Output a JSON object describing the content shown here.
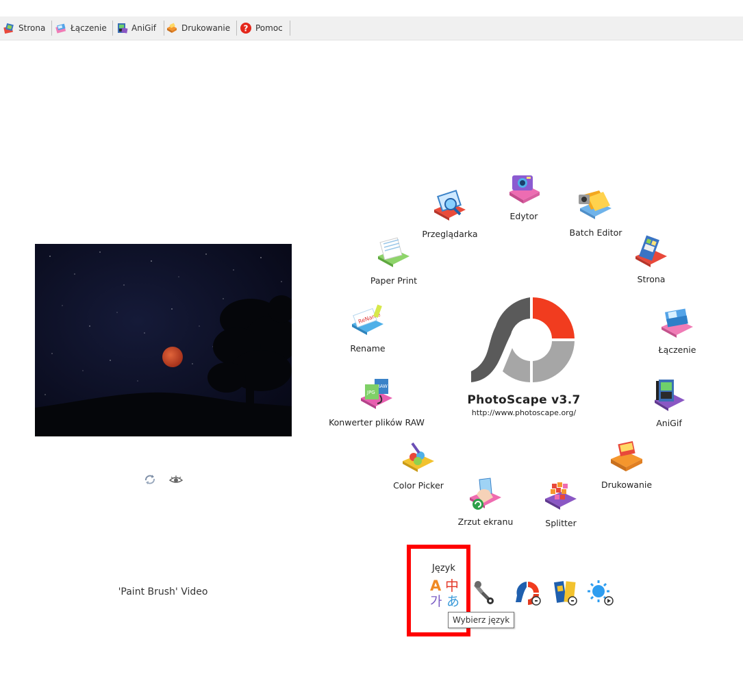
{
  "tabs": [
    {
      "label": "Strona",
      "icon": "strona-icon"
    },
    {
      "label": "Łączenie",
      "icon": "laczenie-icon"
    },
    {
      "label": "AniGif",
      "icon": "anigif-icon"
    },
    {
      "label": "Drukowanie",
      "icon": "drukowanie-icon"
    },
    {
      "label": "Pomoc",
      "icon": "help-icon"
    }
  ],
  "preview": {
    "caption": "'Paint Brush' Video"
  },
  "apps": {
    "edytor": "Edytor",
    "batch_editor": "Batch Editor",
    "przegladarka": "Przeglądarka",
    "strona": "Strona",
    "paper_print": "Paper Print",
    "laczenie": "Łączenie",
    "rename": "Rename",
    "anigif": "AniGif",
    "konwerter": "Konwerter plików RAW",
    "drukowanie": "Drukowanie",
    "color_picker": "Color Picker",
    "zrzut": "Zrzut ekranu",
    "splitter": "Splitter"
  },
  "logo": {
    "title": "PhotoScape v3.7",
    "url": "http://www.photoscape.org/",
    "colors": {
      "dark": "#5a5a5a",
      "light": "#a6a6a6",
      "accent": "#f13c1f"
    }
  },
  "toolbar": {
    "language_label": "Język",
    "language_tooltip": "Wybierz język",
    "icons": [
      "language-icon",
      "tools-icon",
      "photoscape-x-icon",
      "photoscape-icon",
      "sun-icon"
    ]
  },
  "highlight_color": "#ff0000"
}
